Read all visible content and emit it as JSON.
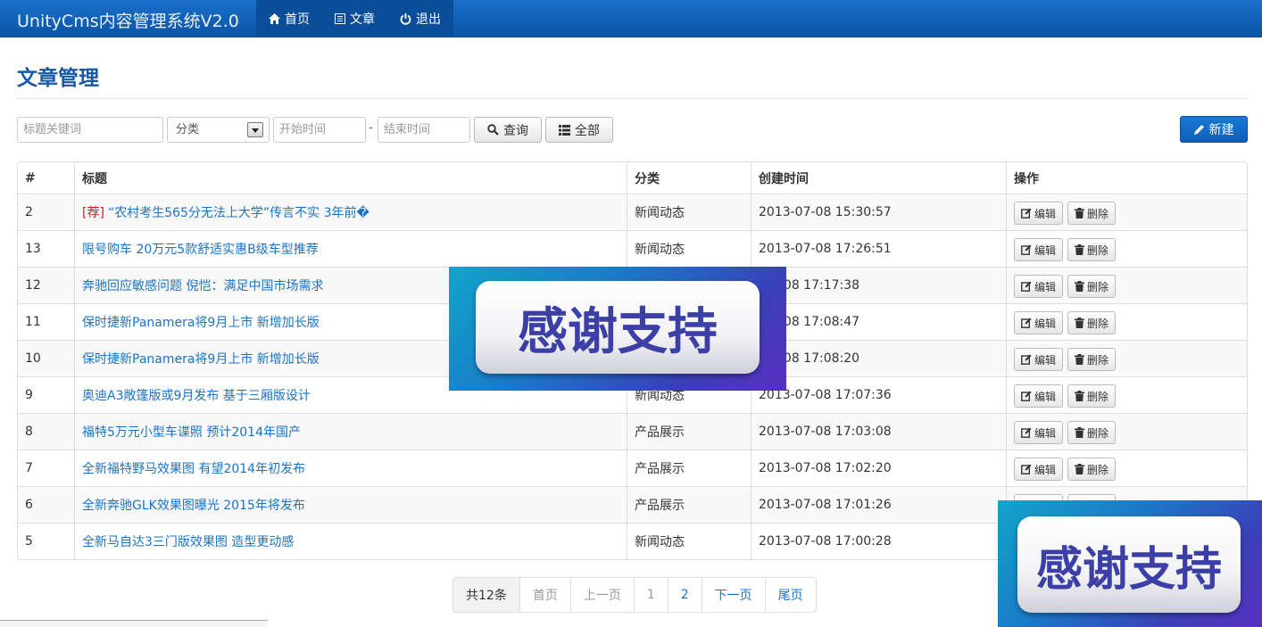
{
  "navbar": {
    "brand": "UnityCms内容管理系统V2.0",
    "items": [
      {
        "label": "首页",
        "icon": "home-icon"
      },
      {
        "label": "文章",
        "icon": "list-alt-icon"
      },
      {
        "label": "退出",
        "icon": "power-off-icon"
      }
    ]
  },
  "page": {
    "title": "文章管理"
  },
  "filters": {
    "keyword_placeholder": "标题关键词",
    "category_value": "分类",
    "start_placeholder": "开始时间",
    "end_placeholder": "结束时间",
    "separator": "-",
    "query_label": "查询",
    "all_label": "全部",
    "new_label": "新建"
  },
  "table": {
    "headers": [
      "#",
      "标题",
      "分类",
      "创建时间",
      "操作"
    ],
    "edit_label": "编辑",
    "delete_label": "删除",
    "rows": [
      {
        "id": "2",
        "tag": "[荐]",
        "title": "“农村考生565分无法上大学”传言不实 3年前�",
        "category": "新闻动态",
        "created": "2013-07-08 15:30:57"
      },
      {
        "id": "13",
        "tag": "",
        "title": "限号购车 20万元5款舒适实惠B级车型推荐",
        "category": "新闻动态",
        "created": "2013-07-08 17:26:51"
      },
      {
        "id": "12",
        "tag": "",
        "title": "奔驰回应敏感问题 倪恺：满足中国市场需求",
        "category": "",
        "created": "-07-08 17:17:38"
      },
      {
        "id": "11",
        "tag": "",
        "title": "保时捷新Panamera将9月上市 新增加长版",
        "category": "",
        "created": "-07-08 17:08:47"
      },
      {
        "id": "10",
        "tag": "",
        "title": "保时捷新Panamera将9月上市 新增加长版",
        "category": "",
        "created": "-07-08 17:08:20"
      },
      {
        "id": "9",
        "tag": "",
        "title": "奥迪A3敞篷版或9月发布 基于三厢版设计",
        "category": "新闻动态",
        "created": "2013-07-08 17:07:36"
      },
      {
        "id": "8",
        "tag": "",
        "title": "福特5万元小型车谍照 预计2014年国产",
        "category": "产品展示",
        "created": "2013-07-08 17:03:08"
      },
      {
        "id": "7",
        "tag": "",
        "title": "全新福特野马效果图 有望2014年初发布",
        "category": "产品展示",
        "created": "2013-07-08 17:02:20"
      },
      {
        "id": "6",
        "tag": "",
        "title": "全新奔驰GLK效果图曝光 2015年将发布",
        "category": "产品展示",
        "created": "2013-07-08 17:01:26"
      },
      {
        "id": "5",
        "tag": "",
        "title": "全新马自达3三门版效果图 造型更动感",
        "category": "新闻动态",
        "created": "2013-07-08 17:00:28"
      }
    ]
  },
  "pagination": {
    "total": "共12条",
    "first": "首页",
    "prev": "上一页",
    "pages": [
      "1",
      "2"
    ],
    "next": "下一页",
    "last": "尾页"
  },
  "overlays": {
    "text": "感谢支持"
  },
  "colors": {
    "navbar": "#0a56a8",
    "accent": "#1a73c6",
    "title": "#1559a6",
    "tag": "#d21a1a",
    "primary_button": "#1a78d4"
  }
}
